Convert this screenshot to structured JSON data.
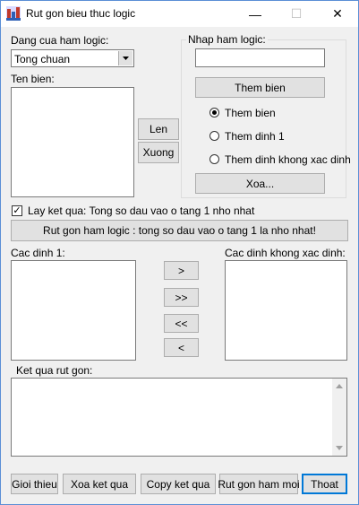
{
  "window": {
    "title": "Rut gon bieu thuc logic",
    "minimize": "—",
    "maximize": "☐",
    "close": "✕"
  },
  "form": {
    "type_label": "Dang cua ham logic:",
    "type_value": "Tong chuan",
    "var_label": "Ten bien:",
    "up_button": "Len",
    "down_button": "Xuong",
    "input_group_title": "Nhap ham logic:",
    "input_value": "",
    "add_button": "Them bien",
    "radios": [
      {
        "label": "Them bien",
        "checked": true
      },
      {
        "label": "Them dinh 1",
        "checked": false
      },
      {
        "label": "Them dinh khong xac dinh",
        "checked": false
      }
    ],
    "delete_button": "Xoa...",
    "checkbox_label": "Lay ket qua: Tong so dau vao o tang 1 nho nhat",
    "checkbox_checked": true,
    "reduce_button": "Rut gon ham logic : tong so dau vao o tang 1 la nho nhat!",
    "ones_label": "Cac dinh 1:",
    "dontcare_label": "Cac dinh khong xac dinh:",
    "move_buttons": [
      ">",
      ">>",
      "<<",
      "<"
    ],
    "result_label": "Ket qua rut gon:",
    "result_value": ""
  },
  "bottom_buttons": [
    "Gioi thieu",
    "Xoa ket qua",
    "Copy ket qua",
    "Rut gon ham moi",
    "Thoat"
  ]
}
